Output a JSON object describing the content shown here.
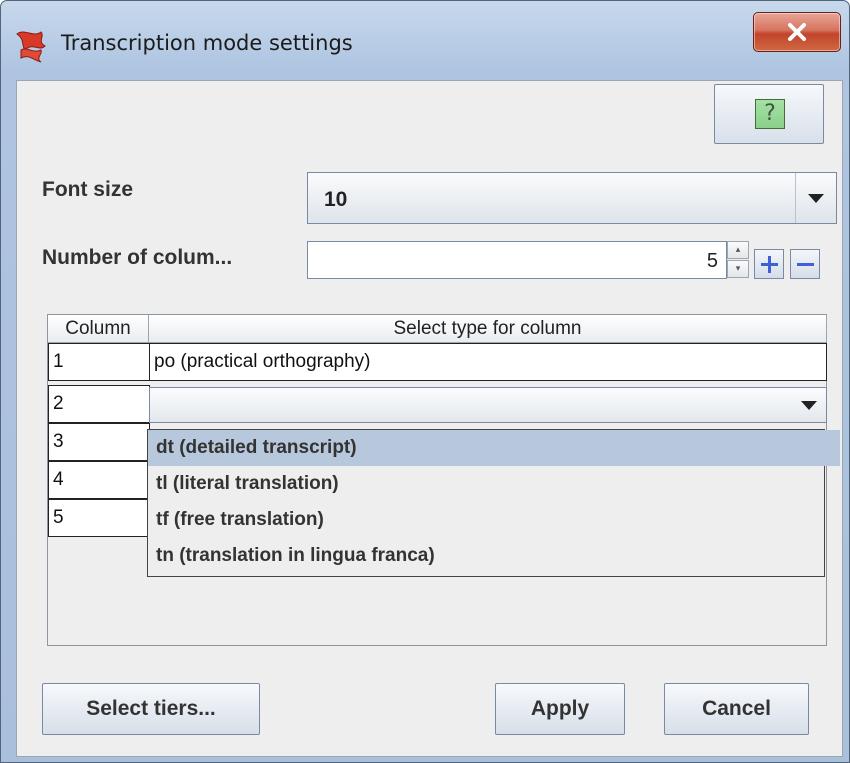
{
  "window": {
    "title": "Transcription mode settings",
    "close_symbol": "x"
  },
  "help": {
    "symbol": "?"
  },
  "font_size": {
    "label": "Font size",
    "value": "10"
  },
  "columns": {
    "label": "Number of colum...",
    "value": "5",
    "spin_up": "▴",
    "spin_down": "▾"
  },
  "table": {
    "headers": [
      "Column",
      "Select type for column"
    ],
    "rows": [
      {
        "column": "1",
        "type": "po (practical orthography)"
      },
      {
        "column": "2",
        "type": ""
      },
      {
        "column": "3",
        "type": ""
      },
      {
        "column": "4",
        "type": ""
      },
      {
        "column": "5",
        "type": ""
      }
    ]
  },
  "dropdown": {
    "options": [
      "dt (detailed transcript)",
      "tl (literal translation)",
      "tf (free translation)",
      "tn (translation in lingua franca)"
    ],
    "selected_index": 0
  },
  "buttons": {
    "select_tiers": "Select tiers...",
    "apply": "Apply",
    "cancel": "Cancel"
  },
  "colors": {
    "selection": "#b8c8dc",
    "close_button": "#c3432a",
    "plus_minus": "#4060d8"
  },
  "icons": {
    "app": "transcription-app-icon",
    "help": "help-question-icon",
    "close": "close-icon",
    "dropdown_arrow": "chevron-down-icon",
    "add": "plus-icon",
    "remove": "minus-icon"
  }
}
